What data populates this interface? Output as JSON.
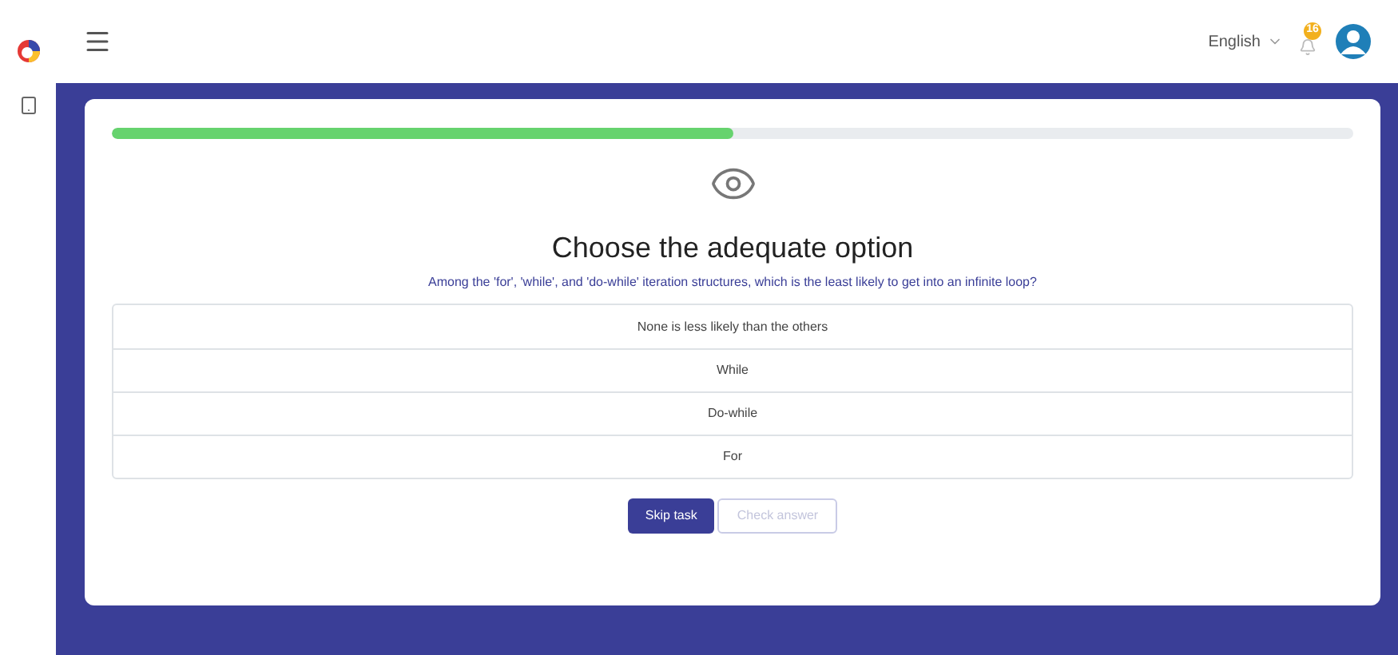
{
  "header": {
    "language": "English",
    "notification_count": "16"
  },
  "task": {
    "progress": {
      "level": 0.5
    },
    "title": "Choose the adequate option",
    "question": "Among the 'for', 'while', and 'do-while' iteration structures, which is the least likely to get into an infinite loop?",
    "options": [
      {
        "label": "None is less likely than the others",
        "selected": false
      },
      {
        "label": "While",
        "selected": false
      },
      {
        "label": "Do-while",
        "selected": false
      },
      {
        "label": "For",
        "selected": false
      }
    ],
    "buttons": [
      {
        "label": "Skip task",
        "disabled": false
      },
      {
        "label": "Check answer",
        "disabled": true
      }
    ]
  }
}
